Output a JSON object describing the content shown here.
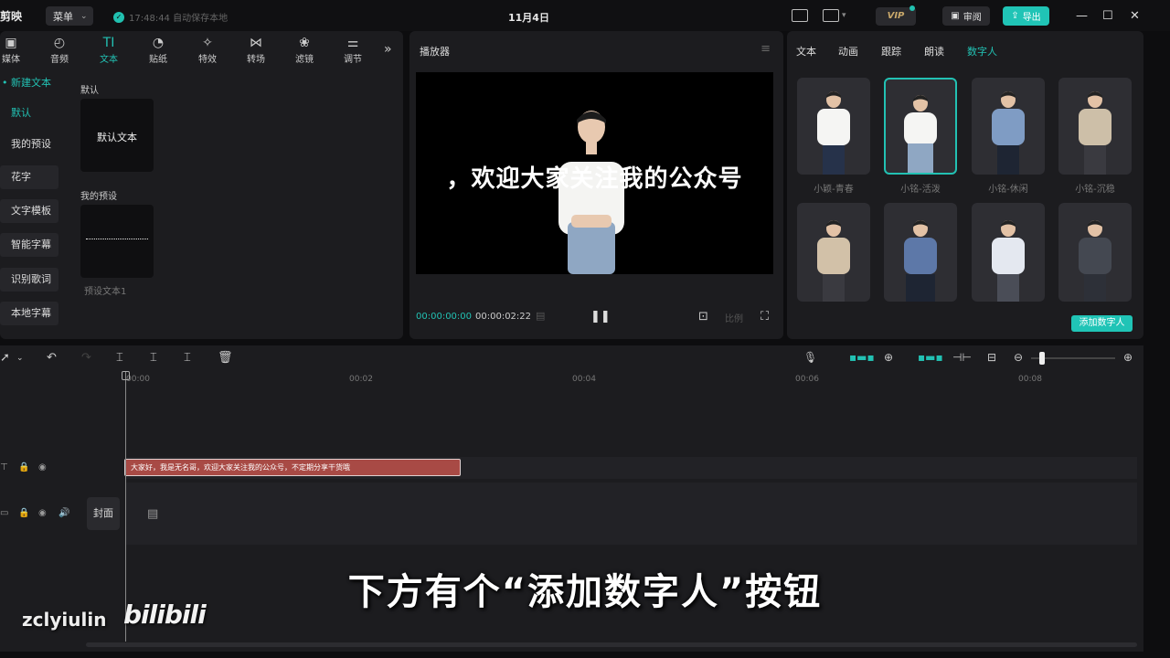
{
  "titlebar": {
    "app_name": "剪映",
    "menu_label": "菜单",
    "save_status": "17:48:44 自动保存本地",
    "doc_title": "11月4日",
    "vip_label": "VIP",
    "review_label": "审阅",
    "export_label": "导出"
  },
  "toolbar": {
    "tools": [
      {
        "label": "媒体",
        "icon": "media-icon"
      },
      {
        "label": "音频",
        "icon": "audio-icon"
      },
      {
        "label": "文本",
        "icon": "text-icon"
      },
      {
        "label": "贴纸",
        "icon": "sticker-icon"
      },
      {
        "label": "特效",
        "icon": "effects-icon"
      },
      {
        "label": "转场",
        "icon": "transition-icon"
      },
      {
        "label": "滤镜",
        "icon": "filter-icon"
      },
      {
        "label": "调节",
        "icon": "adjust-icon"
      }
    ],
    "more": "»"
  },
  "sidenav": {
    "header": "• 新建文本",
    "items": [
      "默认",
      "我的预设",
      "花字",
      "文字模板",
      "智能字幕",
      "识别歌词",
      "本地字幕"
    ]
  },
  "content": {
    "section_default": "默认",
    "default_card_text": "默认文本",
    "section_presets": "我的预设",
    "preset_caption": "预设文本1"
  },
  "player": {
    "title": "播放器",
    "stage_subtitle": "，欢迎大家关注我的公众号",
    "time_current": "00:00:00:00",
    "time_total": "00:00:02:22",
    "ratio_label": "比例"
  },
  "right_panel": {
    "tabs": [
      "文本",
      "动画",
      "跟踪",
      "朗读",
      "数字人"
    ],
    "active_tab": "数字人",
    "avatars_row1": [
      "小颖-青春",
      "小铭-活泼",
      "小铭-休闲",
      "小铭-沉稳"
    ],
    "add_button": "添加数字人"
  },
  "timeline": {
    "ruler": [
      "00:00",
      "00:02",
      "00:04",
      "00:06",
      "00:08"
    ],
    "text_clip": "大家好，我是无名哥，欢迎大家关注我的公众号，不定期分享干货哦",
    "cover_label": "封面"
  },
  "overlay": {
    "subtitle": "下方有个“添加数字人”按钮",
    "username": "zclyiulin",
    "logo": "bilibili"
  },
  "colors": {
    "accent": "#22c1b3",
    "clip": "#a84a45",
    "panel": "#1c1c1f"
  }
}
